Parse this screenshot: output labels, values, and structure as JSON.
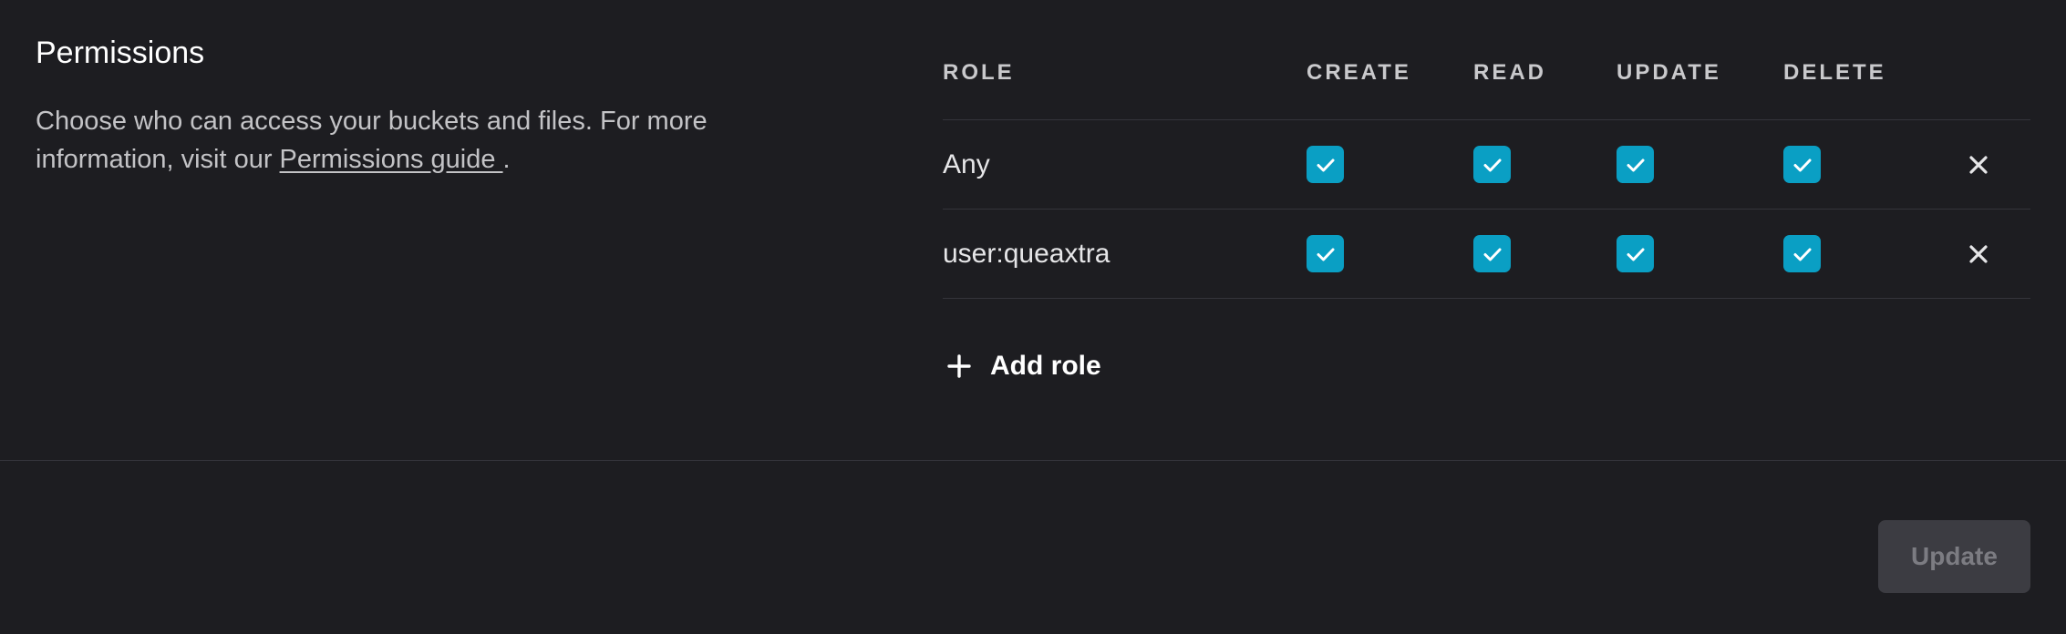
{
  "section": {
    "title": "Permissions",
    "description_prefix": "Choose who can access your buckets and files. For more information, visit our ",
    "guide_link": "Permissions guide ",
    "description_suffix": "."
  },
  "table": {
    "headers": {
      "role": "ROLE",
      "create": "CREATE",
      "read": "READ",
      "update": "UPDATE",
      "delete": "DELETE"
    },
    "rows": [
      {
        "role": "Any",
        "create": true,
        "read": true,
        "update": true,
        "delete": true
      },
      {
        "role": "user:queaxtra",
        "create": true,
        "read": true,
        "update": true,
        "delete": true
      }
    ]
  },
  "actions": {
    "add_role_label": "Add role",
    "update_label": "Update",
    "update_disabled": true
  },
  "icons": {
    "check": "check-icon",
    "remove": "close-icon",
    "add": "plus-icon"
  },
  "colors": {
    "background": "#1d1d21",
    "checkbox": "#0a9fc4",
    "divider": "#34343b",
    "button_disabled_bg": "#3c3c42",
    "button_disabled_text": "#7c7c82"
  }
}
